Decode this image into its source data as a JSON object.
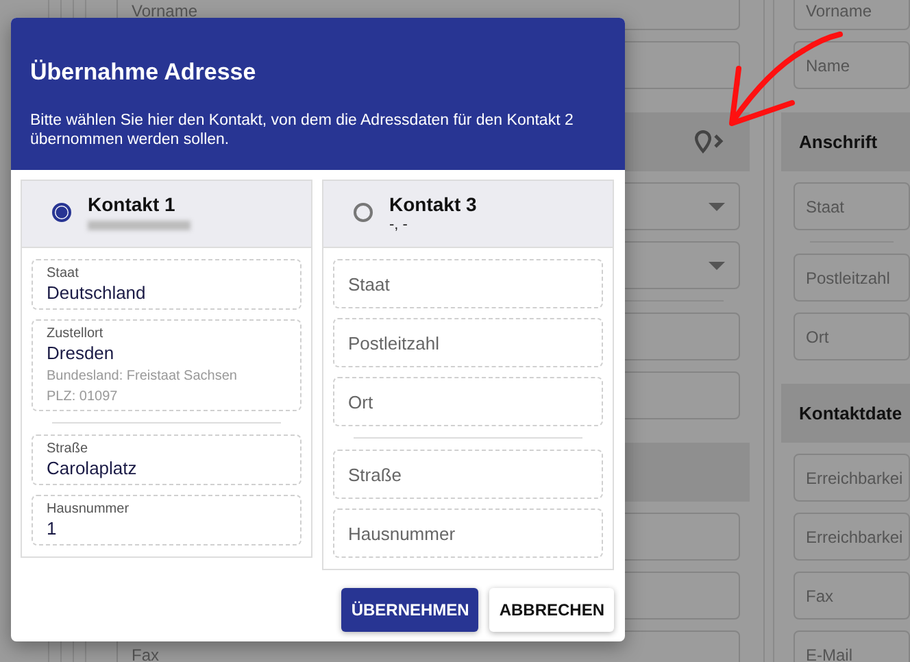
{
  "background_form": {
    "left_column": [
      {
        "kind": "field",
        "label": "Vorname"
      },
      {
        "kind": "field"
      },
      {
        "kind": "header",
        "address_icon": true
      },
      {
        "kind": "select"
      },
      {
        "kind": "select"
      },
      {
        "kind": "divider"
      },
      {
        "kind": "field"
      },
      {
        "kind": "field"
      },
      {
        "kind": "header"
      },
      {
        "kind": "field"
      },
      {
        "kind": "field"
      },
      {
        "kind": "field",
        "label": "Fax"
      }
    ],
    "right_column": [
      {
        "kind": "field",
        "label": "Vorname"
      },
      {
        "kind": "field",
        "label": "Name"
      },
      {
        "kind": "header",
        "label": "Anschrift"
      },
      {
        "kind": "field",
        "label": "Staat"
      },
      {
        "kind": "divider"
      },
      {
        "kind": "field",
        "label": "Postleitzahl"
      },
      {
        "kind": "field",
        "label": "Ort"
      },
      {
        "kind": "header",
        "label": "Kontaktdate"
      },
      {
        "kind": "field",
        "label": "Erreichbarkei"
      },
      {
        "kind": "field",
        "label": "Erreichbarkei"
      },
      {
        "kind": "field",
        "label": "Fax"
      },
      {
        "kind": "field",
        "label": "E-Mail"
      }
    ]
  },
  "dialog": {
    "title": "Übernahme Adresse",
    "description": "Bitte wählen Sie hier den Kontakt, von dem die Adressdaten für den Kontakt 2 übernommen werden sollen.",
    "contacts": [
      {
        "title": "Kontakt 1",
        "selected": true,
        "subtitle_redacted": true,
        "fields": [
          {
            "kind": "filled",
            "label": "Staat",
            "value": "Deutschland"
          },
          {
            "kind": "filled",
            "label": "Zustellort",
            "value": "Dresden",
            "details": [
              "Bundesland: Freistaat Sachsen",
              "PLZ: 01097"
            ]
          },
          {
            "kind": "divider"
          },
          {
            "kind": "filled",
            "label": "Straße",
            "value": "Carolaplatz"
          },
          {
            "kind": "filled",
            "label": "Hausnummer",
            "value": "1"
          }
        ]
      },
      {
        "title": "Kontakt 3",
        "selected": false,
        "subtitle": "-, -",
        "fields": [
          {
            "kind": "empty",
            "placeholder": "Staat"
          },
          {
            "kind": "empty",
            "placeholder": "Postleitzahl"
          },
          {
            "kind": "empty",
            "placeholder": "Ort"
          },
          {
            "kind": "divider"
          },
          {
            "kind": "empty",
            "placeholder": "Straße"
          },
          {
            "kind": "empty",
            "placeholder": "Hausnummer"
          }
        ]
      }
    ],
    "buttons": [
      {
        "label": "ÜBERNEHMEN",
        "primary": true
      },
      {
        "label": "ABBRECHEN",
        "primary": false
      }
    ]
  },
  "annotation": {
    "arrow": true
  }
}
